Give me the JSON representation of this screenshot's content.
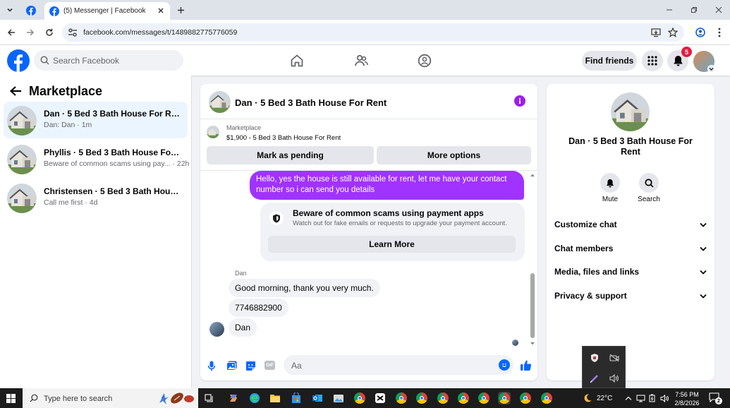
{
  "browser": {
    "active_tab_title": "(5) Messenger | Facebook",
    "url": "facebook.com/messages/t/1489882775776059"
  },
  "fb": {
    "search_placeholder": "Search Facebook",
    "find_friends": "Find friends",
    "notification_count": "5"
  },
  "sidebar": {
    "title": "Marketplace",
    "conversations": [
      {
        "name": "Dan · 5 Bed 3 Bath House For Rent",
        "preview": "Dan: Dan · 1m",
        "selected": true
      },
      {
        "name": "Phyllis · 5 Bed 3 Bath House For R...",
        "preview": "Beware of common scams using pay... · 22h",
        "selected": false
      },
      {
        "name": "Christensen · 5 Bed 3 Bath House ...",
        "preview": "Call me first · 4d",
        "selected": false
      }
    ]
  },
  "chat": {
    "title": "Dan · 5 Bed 3 Bath House For Rent",
    "listing_label": "Marketplace",
    "listing_price": "$1,900 - 5 Bed 3 Bath House For Rent",
    "mark_pending": "Mark as pending",
    "more_options": "More options",
    "outgoing_message": "Hello, yes the house is still available for rent, let me have your contact number so i can send you  details",
    "warning_title": "Beware of common scams using payment apps",
    "warning_subtitle": "Watch out for fake emails or requests to upgrade your payment account.",
    "learn_more": "Learn More",
    "sender_name": "Dan",
    "incoming": [
      "Good morning, thank you very much.",
      "7746882900",
      "Dan"
    ],
    "compose_placeholder": "Aa"
  },
  "details": {
    "title": "Dan · 5 Bed 3 Bath House For Rent",
    "mute": "Mute",
    "search": "Search",
    "sections": [
      "Customize chat",
      "Chat members",
      "Media, files and links",
      "Privacy & support"
    ]
  },
  "taskbar": {
    "search_placeholder": "Type here to search",
    "temperature": "22°C",
    "time": "7:56 PM",
    "date": "2/8/2026",
    "notification_count": "2"
  },
  "colors": {
    "facebook_blue": "#0866ff",
    "messenger_purple": "#a033ff",
    "badge_red": "#e41e3f"
  }
}
